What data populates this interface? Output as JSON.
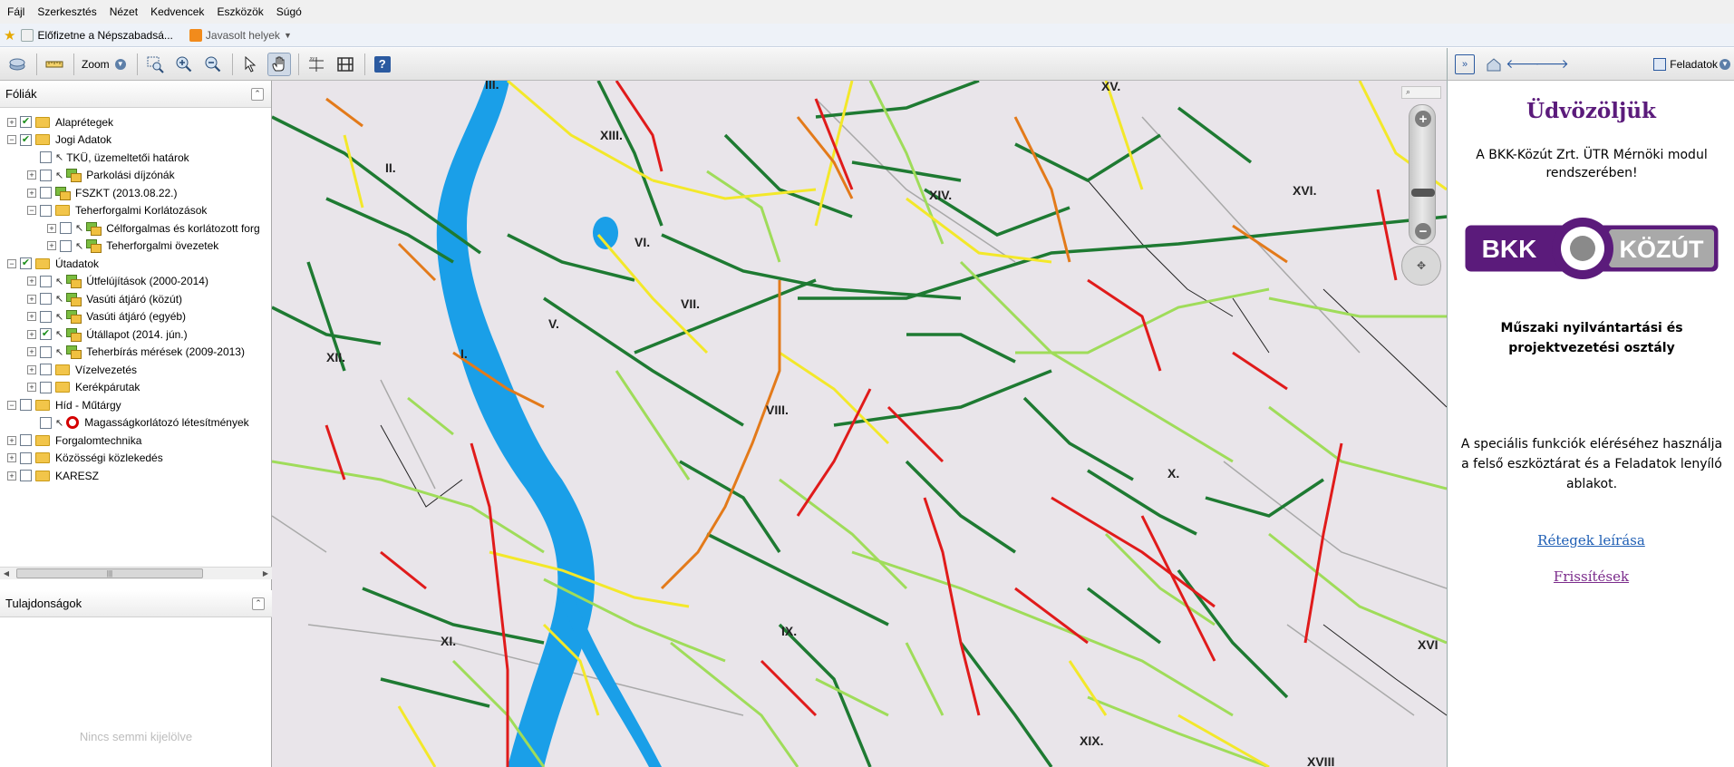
{
  "browser": {
    "menu": [
      "Fájl",
      "Szerkesztés",
      "Nézet",
      "Kedvencek",
      "Eszközök",
      "Súgó"
    ],
    "favorites": [
      "Előfizetne a Népszabadsá...",
      "Javasolt helyek"
    ]
  },
  "toolbar": {
    "zoom_label": "Zoom",
    "icons": [
      "layers-refresh-icon",
      "measure-icon",
      "zoom-dropdown",
      "zoom-rectangle-icon",
      "zoom-in-icon",
      "zoom-out-icon",
      "select-arrow-icon",
      "pan-hand-icon",
      "coordinate-icon",
      "profile-icon",
      "help-icon"
    ]
  },
  "right_toolbar": {
    "tasks_label": "Feladatok"
  },
  "left_panel": {
    "layers_title": "Fóliák",
    "properties_title": "Tulajdonságok",
    "empty_selection": "Nincs semmi kijelölve",
    "tree": [
      {
        "indent": 0,
        "pm": "+",
        "checked": true,
        "type": "folder",
        "label": "Alaprétegek"
      },
      {
        "indent": 0,
        "pm": "−",
        "checked": true,
        "type": "folder",
        "label": "Jogi Adatok"
      },
      {
        "indent": 1,
        "pm": "",
        "checked": false,
        "type": "plain",
        "label": "TKÜ, üzemeltetői határok"
      },
      {
        "indent": 1,
        "pm": "+",
        "checked": false,
        "type": "layer",
        "label": "Parkolási díjzónák"
      },
      {
        "indent": 1,
        "pm": "+",
        "checked": false,
        "type": "layer-nocursor",
        "label": "FSZKT (2013.08.22.)"
      },
      {
        "indent": 1,
        "pm": "−",
        "checked": false,
        "type": "folder",
        "label": "Teherforgalmi Korlátozások"
      },
      {
        "indent": 2,
        "pm": "+",
        "checked": false,
        "type": "layer",
        "label": "Célforgalmas és korlátozott forg"
      },
      {
        "indent": 2,
        "pm": "+",
        "checked": false,
        "type": "layer",
        "label": "Teherforgalmi övezetek"
      },
      {
        "indent": 0,
        "pm": "−",
        "checked": true,
        "type": "folder",
        "label": "Útadatok"
      },
      {
        "indent": 1,
        "pm": "+",
        "checked": false,
        "type": "layer",
        "label": "Útfelújítások (2000-2014)"
      },
      {
        "indent": 1,
        "pm": "+",
        "checked": false,
        "type": "layer",
        "label": "Vasúti átjáró (közút)"
      },
      {
        "indent": 1,
        "pm": "+",
        "checked": false,
        "type": "layer",
        "label": "Vasúti átjáró (egyéb)"
      },
      {
        "indent": 1,
        "pm": "+",
        "checked": true,
        "type": "layer",
        "label": "Útállapot (2014. jún.)"
      },
      {
        "indent": 1,
        "pm": "+",
        "checked": false,
        "type": "layer",
        "label": "Teherbírás mérések (2009-2013)"
      },
      {
        "indent": 1,
        "pm": "+",
        "checked": false,
        "type": "folder",
        "label": "Vízelvezetés"
      },
      {
        "indent": 1,
        "pm": "+",
        "checked": false,
        "type": "folder",
        "label": "Kerékpárutak"
      },
      {
        "indent": 0,
        "pm": "−",
        "checked": false,
        "type": "folder",
        "label": "Híd - Műtárgy"
      },
      {
        "indent": 1,
        "pm": "",
        "checked": false,
        "type": "stop",
        "label": "Magasságkorlátozó létesítmények"
      },
      {
        "indent": 0,
        "pm": "+",
        "checked": false,
        "type": "folder",
        "label": "Forgalomtechnika"
      },
      {
        "indent": 0,
        "pm": "+",
        "checked": false,
        "type": "folder",
        "label": "Közösségi közlekedés"
      },
      {
        "indent": 0,
        "pm": "+",
        "checked": false,
        "type": "folder",
        "label": "KARESZ"
      }
    ]
  },
  "map": {
    "search_placeholder": "",
    "districts": [
      "III.",
      "II.",
      "XIII.",
      "XV.",
      "XIV.",
      "XVI.",
      "VI.",
      "VII.",
      "V.",
      "XII.",
      "I.",
      "VIII.",
      "X.",
      "IX.",
      "XI.",
      "XIX.",
      "XVIII",
      "XVI"
    ],
    "colors": {
      "good": "#1e7a32",
      "light": "#9fdc5a",
      "medium": "#f3e82a",
      "poor": "#e37a1a",
      "bad": "#e01b1b",
      "river": "#1a9fe8"
    }
  },
  "right_panel": {
    "welcome": "Üdvözöljük",
    "intro": "A BKK-Közút Zrt. ÜTR Mérnöki modul rendszerében!",
    "logo_left": "BKK",
    "logo_right": "KÖZÚT",
    "department": "Műszaki nyilvántartási és projektvezetési osztály",
    "hint": "A speciális funkciók eléréséhez használja a felső eszköztárat és a Feladatok lenyíló ablakot.",
    "link_layers": "Rétegek leírása",
    "link_refresh": "Frissítések"
  }
}
